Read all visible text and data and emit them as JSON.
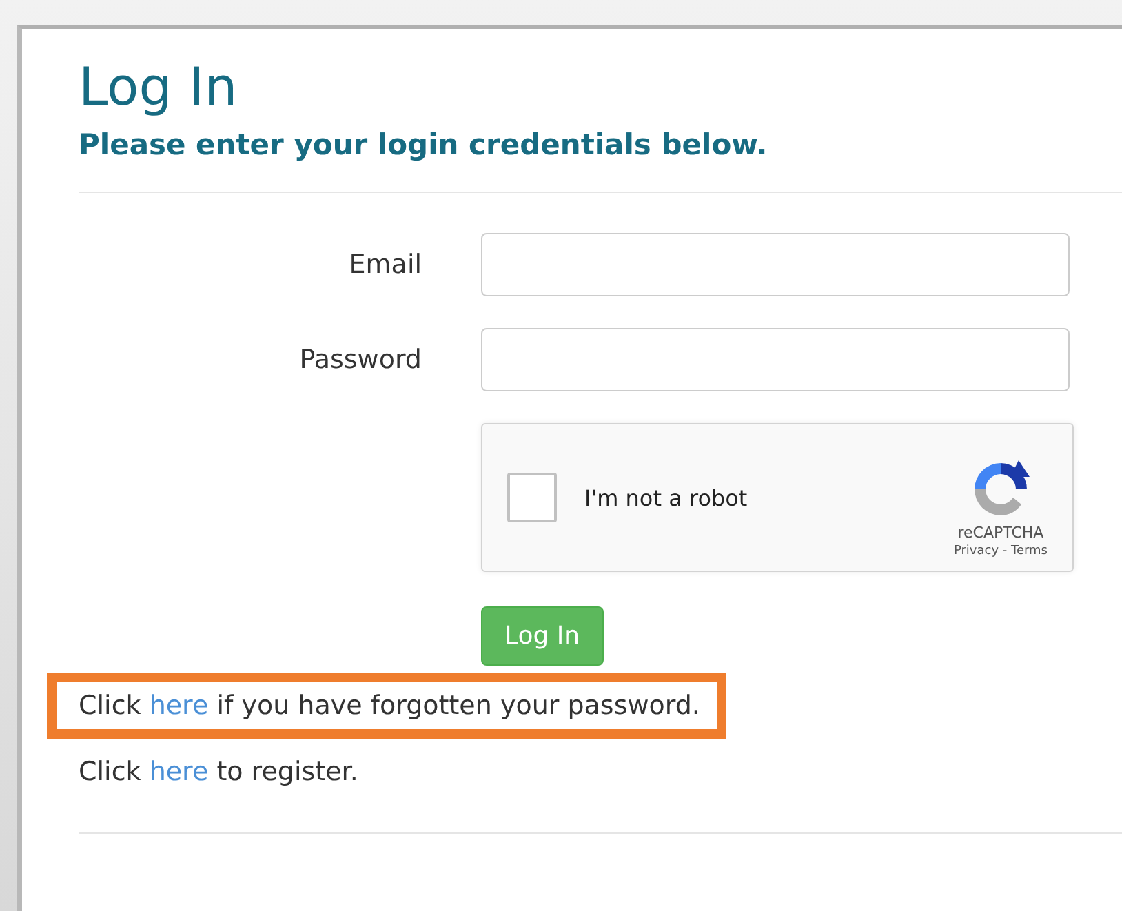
{
  "title": "Log In",
  "subtitle": "Please enter your login credentials below.",
  "fields": [
    {
      "label": "Email"
    },
    {
      "label": "Password"
    }
  ],
  "captcha": {
    "label": "I'm not a robot",
    "checked": false,
    "brand": "reCAPTCHA",
    "links": "Privacy - Terms"
  },
  "submit": "Log In",
  "help_lines": [
    {
      "before": "Click ",
      "link": "here",
      "after": " if you have forgotten your password.",
      "highlighted": true
    },
    {
      "before": "Click ",
      "link": "here",
      "after": " to register.",
      "highlighted": false
    }
  ]
}
